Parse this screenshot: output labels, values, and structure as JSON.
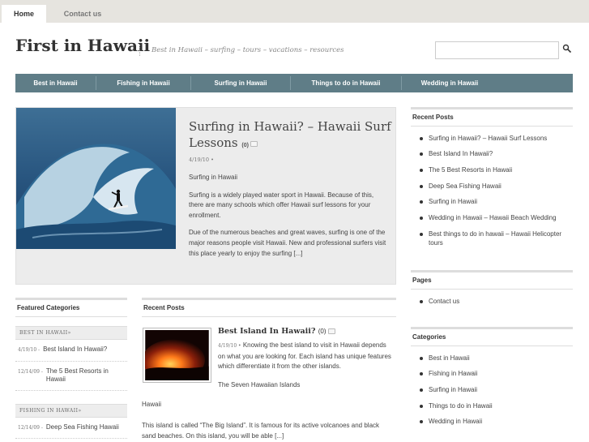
{
  "top_tabs": {
    "home": "Home",
    "contact": "Contact us"
  },
  "header": {
    "site_title": "First in Hawaii",
    "tagline": "Best in Hawaii – surfing – tours – vacations – resources",
    "search_placeholder": ""
  },
  "nav": {
    "items": [
      "Best in Hawaii",
      "Fishing in Hawaii",
      "Surfing in Hawaii",
      "Things to do in Hawaii",
      "Wedding in Hawaii"
    ]
  },
  "featured": {
    "title": "Surfing in Hawaii? – Hawaii Surf Lessons",
    "comment_count": "(0)",
    "date": "4/19/10 •",
    "subtitle": "Surfing in Hawaii",
    "para1": "Surfing is a widely played water sport in Hawaii. Because of this, there are many schools which offer Hawaii surf lessons for your enrollment.",
    "para2": "Due of the numerous beaches and great waves, surfing is one of the major reasons people visit Hawaii. New and professional surfers visit this place yearly to enjoy the surfing [...]"
  },
  "sidebar_recent": {
    "heading": "Recent Posts",
    "items": [
      "Surfing in Hawaii? – Hawaii Surf Lessons",
      "Best Island In Hawaii?",
      "The 5 Best Resorts in Hawaii",
      "Deep Sea Fishing Hawaii",
      "Surfing in Hawaii",
      "Wedding in Hawaii – Hawaii Beach Wedding",
      "Best things to do in hawaii – Hawaii Helicopter tours"
    ]
  },
  "sidebar_pages": {
    "heading": "Pages",
    "items": [
      "Contact us"
    ]
  },
  "sidebar_categories": {
    "heading": "Categories",
    "items": [
      "Best in Hawaii",
      "Fishing in Hawaii",
      "Surfing in Hawaii",
      "Things to do in Hawaii",
      "Wedding in Hawaii"
    ]
  },
  "featured_categories": {
    "heading": "Featured Categories",
    "groups": [
      {
        "label": "BEST IN HAWAII»",
        "items": [
          {
            "date": "4/19/10 -",
            "title": "Best Island In Hawaii?"
          },
          {
            "date": "12/14/09 -",
            "title": "The 5 Best Resorts in Hawaii"
          }
        ]
      },
      {
        "label": "FISHING IN HAWAII»",
        "items": [
          {
            "date": "12/14/09 -",
            "title": "Deep Sea Fishing Hawaii"
          }
        ]
      }
    ]
  },
  "recent_posts": {
    "heading": "Recent Posts",
    "post_title": "Best Island In Hawaii?",
    "comment_count": "(0)",
    "date": "4/19/10 •",
    "excerpt": "Knowing the best island to visit in Hawaii depends on what you are looking for. Each island has unique features which differentiate it from the other islands.",
    "subheading": "The Seven Hawaiian Islands",
    "island": "Hawaii",
    "paragraph": "This island is called “The Big Island”. It is famous for its active volcanoes and black sand beaches. On this island, you will be able [...]"
  },
  "colors": {
    "nav_bg": "#5f7d87",
    "topbar_bg": "#e6e4df",
    "featured_bg": "#ececec"
  }
}
